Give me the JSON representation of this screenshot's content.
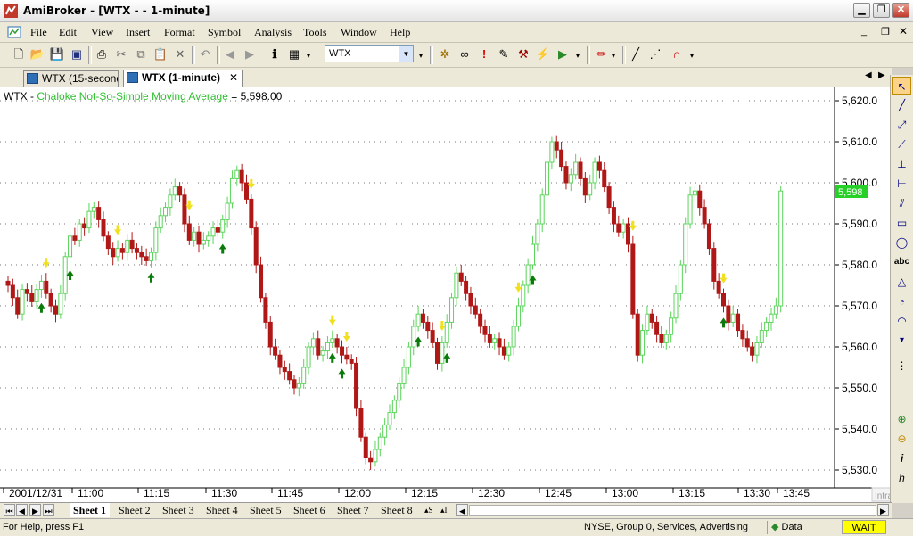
{
  "window": {
    "title": "AmiBroker - [WTX -  - 1-minute]"
  },
  "menu": [
    "File",
    "Edit",
    "View",
    "Insert",
    "Format",
    "Symbol",
    "Analysis",
    "Tools",
    "Window",
    "Help"
  ],
  "toolbar": {
    "symbol_value": "WTX"
  },
  "tabs": [
    {
      "label": "WTX (15-second)",
      "active": false
    },
    {
      "label": "WTX (1-minute)",
      "active": true
    }
  ],
  "legend": {
    "symbol": "WTX",
    "separator": " - ",
    "indicator": "Chaloke Not-So-Simple Moving Average",
    "equals": " = ",
    "value": "5,598.00"
  },
  "chart_data": {
    "type": "bar",
    "style": "candlestick",
    "symbol": "WTX",
    "interval": "1-minute",
    "x_tick_labels": [
      "2001/12/31",
      "11:00",
      "11:15",
      "11:30",
      "11:45",
      "12:00",
      "12:15",
      "12:30",
      "12:45",
      "13:00",
      "13:15",
      "13:30",
      "13:45"
    ],
    "y_tick_labels": [
      "5,620.0",
      "5,610.0",
      "5,600.0",
      "5,590.0",
      "5,580.0",
      "5,570.0",
      "5,560.0",
      "5,550.0",
      "5,540.0",
      "5,530.0"
    ],
    "ylim": [
      5527,
      5624
    ],
    "grid": true,
    "last_price_label": "5,598",
    "up_color": "#5bd45b",
    "down_color": "#b01818",
    "buy_arrow_color": "#0a7a0a",
    "sell_arrow_color": "#f0e020",
    "watermark": "Intraday",
    "closes": [
      5575,
      5572,
      5568,
      5574,
      5573,
      5571,
      5574,
      5576,
      5573,
      5570,
      5568,
      5573,
      5582,
      5587,
      5586,
      5590,
      5589,
      5593,
      5594,
      5591,
      5587,
      5584,
      5582,
      5584,
      5583,
      5586,
      5584,
      5583,
      5582,
      5581,
      5583,
      5589,
      5592,
      5594,
      5597,
      5599,
      5597,
      5590,
      5586,
      5588,
      5585,
      5586,
      5587,
      5589,
      5588,
      5591,
      5595,
      5601,
      5603,
      5600,
      5596,
      5589,
      5580,
      5572,
      5566,
      5560,
      5558,
      5555,
      5554,
      5552,
      5550,
      5551,
      5555,
      5560,
      5562,
      5558,
      5559,
      5561,
      5562,
      5560,
      5558,
      5557,
      5556,
      5545,
      5538,
      5533,
      5532,
      5535,
      5538,
      5541,
      5544,
      5547,
      5551,
      5555,
      5560,
      5565,
      5568,
      5566,
      5564,
      5561,
      5556,
      5561,
      5566,
      5572,
      5578,
      5576,
      5573,
      5570,
      5568,
      5565,
      5563,
      5561,
      5562,
      5560,
      5558,
      5560,
      5565,
      5570,
      5575,
      5580,
      5585,
      5590,
      5597,
      5605,
      5610,
      5608,
      5604,
      5600,
      5602,
      5605,
      5601,
      5597,
      5600,
      5605,
      5603,
      5599,
      5594,
      5590,
      5588,
      5590,
      5585,
      5568,
      5558,
      5564,
      5568,
      5566,
      5563,
      5561,
      5563,
      5567,
      5573,
      5580,
      5590,
      5597,
      5598,
      5594,
      5590,
      5584,
      5576,
      5573,
      5570,
      5566,
      5568,
      5564,
      5562,
      5560,
      5558,
      5561,
      5564,
      5566,
      5568,
      5570,
      5598
    ]
  },
  "drawing_tools": [
    "arrow-select",
    "line",
    "ray",
    "trend-line",
    "vertical-line",
    "horizontal-line",
    "parallel-lines",
    "rectangle",
    "ellipse",
    "text-abc",
    "triangle",
    "arc",
    "curve",
    "zoom-in",
    "zoom-out",
    "info",
    "hand"
  ],
  "sheets": {
    "tabs": [
      "Sheet 1",
      "Sheet 2",
      "Sheet 3",
      "Sheet 4",
      "Sheet 5",
      "Sheet 6",
      "Sheet 7",
      "Sheet 8"
    ],
    "active": "Sheet 1",
    "extra": "▴S",
    "extra2": "▴I"
  },
  "status": {
    "help": "For Help, press F1",
    "market": "NYSE, Group 0, Services, Advertising",
    "data": "Data",
    "wait": "WAIT"
  }
}
